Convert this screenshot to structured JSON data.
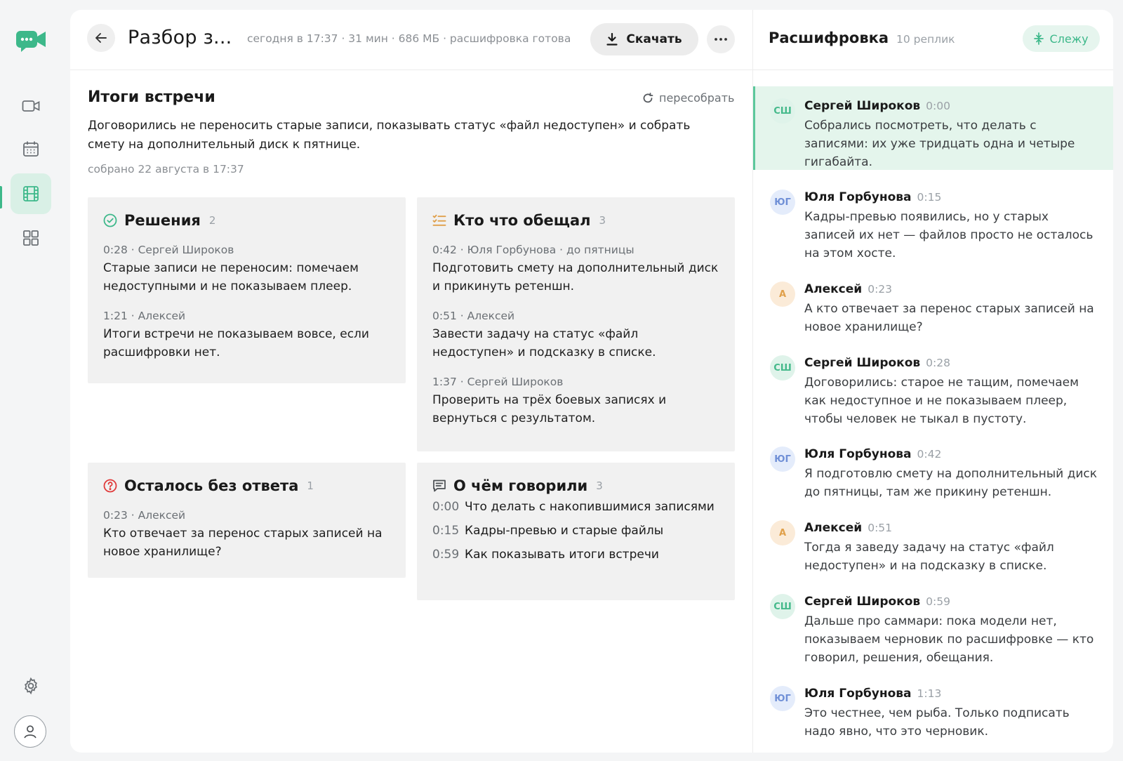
{
  "colors": {
    "accent": "#3db88a",
    "accent_bg": "#d9f0e6",
    "danger": "#e03a3a",
    "promise": "#e0a04a"
  },
  "sidebar": {
    "items": [
      {
        "icon": "video-camera-icon"
      },
      {
        "icon": "calendar-icon"
      },
      {
        "icon": "film-icon",
        "active": true
      },
      {
        "icon": "grid-icon"
      }
    ],
    "settings_icon": "gear-icon",
    "profile_icon": "user-icon"
  },
  "header": {
    "title": "Разбор з...",
    "meta": "сегодня в 17:37 · 31 мин · 686 МБ · расшифровка готова",
    "download_label": "Скачать"
  },
  "summary": {
    "title": "Итоги встречи",
    "rebuild_label": "пересобрать",
    "text": "Договорились не переносить старые записи, показывать статус «файл недоступен» и собрать смету на дополнительный диск к пятнице.",
    "date": "собрано 22 августа в 17:37"
  },
  "decisions": {
    "title": "Решения",
    "count": "2",
    "items": [
      {
        "meta": "0:28 · Сергей Широков",
        "text": "Старые записи не переносим: помечаем недоступными и не показываем плеер."
      },
      {
        "meta": "1:21 · Алексей",
        "text": "Итоги встречи не показываем вовсе, если расшифровки нет."
      }
    ]
  },
  "promises": {
    "title": "Кто что обещал",
    "count": "3",
    "items": [
      {
        "meta": "0:42 · Юля Горбунова · до пятницы",
        "text": "Подготовить смету на дополнительный диск и прикинуть ретеншн."
      },
      {
        "meta": "0:51 · Алексей",
        "text": "Завести задачу на статус «файл недоступен» и подсказку в списке."
      },
      {
        "meta": "1:37 · Сергей Широков",
        "text": "Проверить на трёх боевых записях и вернуться с результатом."
      }
    ]
  },
  "open_questions": {
    "title": "Осталось без ответа",
    "count": "1",
    "items": [
      {
        "meta": "0:23 · Алексей",
        "text": "Кто отвечает за перенос старых записей на новое хранилище?"
      }
    ]
  },
  "topics": {
    "title": "О чём говорили",
    "count": "3",
    "items": [
      {
        "time": "0:00",
        "text": "Что делать с накопившимися записями"
      },
      {
        "time": "0:15",
        "text": "Кадры-превью и старые файлы"
      },
      {
        "time": "0:59",
        "text": "Как показывать итоги встречи"
      }
    ]
  },
  "transcript": {
    "title": "Расшифровка",
    "count": "10 реплик",
    "follow_label": "Слежу",
    "replicas": [
      {
        "initials": "СШ",
        "name": "Сергей Широков",
        "time": "0:00",
        "text": "Собрались посмотреть, что делать с записями: их уже тридцать одна и четыре гигабайта."
      },
      {
        "initials": "ЮГ",
        "name": "Юля Горбунова",
        "time": "0:15",
        "text": "Кадры-превью появились, но у старых записей их нет — файлов просто не осталось на этом хосте."
      },
      {
        "initials": "А",
        "name": "Алексей",
        "time": "0:23",
        "text": "А кто отвечает за перенос старых записей на новое хранилище?"
      },
      {
        "initials": "СШ",
        "name": "Сергей Широков",
        "time": "0:28",
        "text": "Договорились: старое не тащим, помечаем как недоступное и не показываем плеер, чтобы человек не тыкал в пустоту."
      },
      {
        "initials": "ЮГ",
        "name": "Юля Горбунова",
        "time": "0:42",
        "text": "Я подготовлю смету на дополнительный диск до пятницы, там же прикину ретеншн."
      },
      {
        "initials": "А",
        "name": "Алексей",
        "time": "0:51",
        "text": "Тогда я заведу задачу на статус «файл недоступен» и на подсказку в списке."
      },
      {
        "initials": "СШ",
        "name": "Сергей Широков",
        "time": "0:59",
        "text": "Дальше про саммари: пока модели нет, показываем черновик по расшифровке — кто говорил, решения, обещания."
      },
      {
        "initials": "ЮГ",
        "name": "Юля Горбунова",
        "time": "1:13",
        "text": "Это честнее, чем рыба. Только подписать надо явно, что это черновик."
      }
    ]
  }
}
